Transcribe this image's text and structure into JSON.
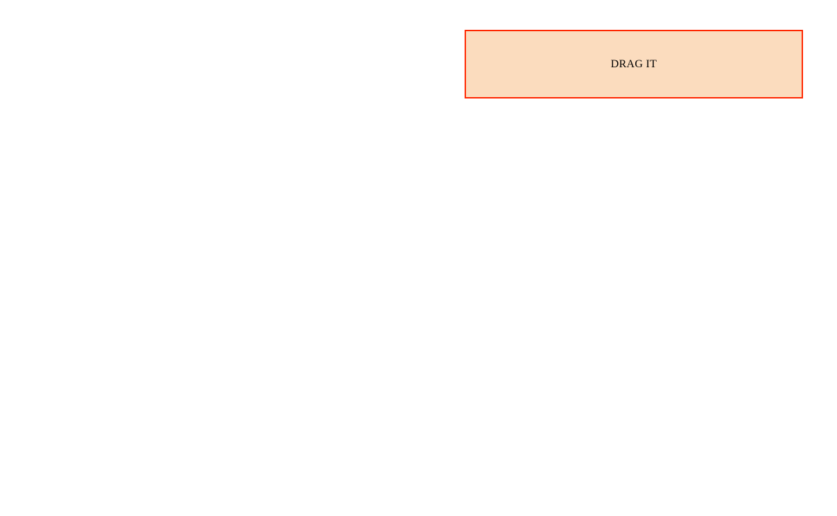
{
  "drag_box": {
    "label": "DRAG IT",
    "colors": {
      "background": "#fbdcbe",
      "border": "#ff2600"
    }
  }
}
